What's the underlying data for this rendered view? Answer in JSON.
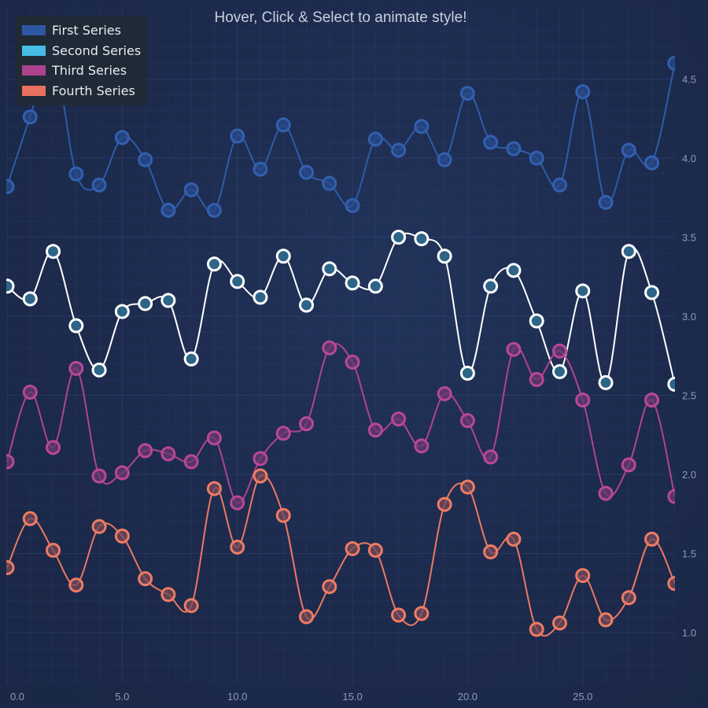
{
  "title": "Hover, Click & Select to animate style!",
  "legend": {
    "items": [
      {
        "label": "First Series",
        "color": "#2e57a3"
      },
      {
        "label": "Second Series",
        "color": "#47bde6"
      },
      {
        "label": "Third Series",
        "color": "#ae418d"
      },
      {
        "label": "Fourth Series",
        "color": "#e8705e"
      }
    ]
  },
  "chart_data": {
    "type": "line",
    "title": "Hover, Click & Select to animate style!",
    "xlabel": "",
    "ylabel": "",
    "xlim": [
      0,
      29
    ],
    "ylim": [
      0.67,
      4.96
    ],
    "grid": true,
    "legend_position": "top-left",
    "y_axis_position": "right",
    "x_ticks": [
      0,
      5,
      10,
      15,
      20,
      25
    ],
    "x_tick_labels": [
      "0.0",
      "5.0",
      "10.0",
      "15.0",
      "20.0",
      "25.0"
    ],
    "y_ticks": [
      1.0,
      1.5,
      2.0,
      2.5,
      3.0,
      3.5,
      4.0,
      4.5
    ],
    "y_tick_labels": [
      "1.0",
      "1.5",
      "2.0",
      "2.5",
      "3.0",
      "3.5",
      "4.0",
      "4.5"
    ],
    "x": [
      0,
      1,
      2,
      3,
      4,
      5,
      6,
      7,
      8,
      9,
      10,
      11,
      12,
      13,
      14,
      15,
      16,
      17,
      18,
      19,
      20,
      21,
      22,
      23,
      24,
      25,
      26,
      27,
      28,
      29
    ],
    "series": [
      {
        "name": "First Series",
        "line_color": "#2f5ba8",
        "marker_fill": "#284a8a",
        "marker_stroke": "#3260b0",
        "values": [
          3.82,
          4.26,
          4.65,
          3.9,
          3.83,
          4.13,
          3.99,
          3.67,
          3.8,
          3.67,
          4.14,
          3.93,
          4.21,
          3.91,
          3.84,
          3.7,
          4.12,
          4.05,
          4.2,
          3.99,
          4.41,
          4.1,
          4.06,
          4.0,
          3.83,
          4.42,
          3.72,
          4.05,
          3.97,
          4.6
        ]
      },
      {
        "name": "Second Series",
        "line_color": "#ffffff",
        "marker_fill": "#2d6488",
        "marker_stroke": "#ffffff",
        "values": [
          3.19,
          3.11,
          3.41,
          2.94,
          2.66,
          3.03,
          3.08,
          3.1,
          2.73,
          3.33,
          3.22,
          3.12,
          3.38,
          3.07,
          3.3,
          3.21,
          3.19,
          3.5,
          3.49,
          3.38,
          2.64,
          3.19,
          3.29,
          2.97,
          2.65,
          3.16,
          2.58,
          3.41,
          3.15,
          2.57
        ]
      },
      {
        "name": "Third Series",
        "line_color": "#b2438f",
        "marker_fill": "#6a3a6e",
        "marker_stroke": "#b9479a",
        "values": [
          2.08,
          2.52,
          2.17,
          2.67,
          1.99,
          2.01,
          2.15,
          2.13,
          2.08,
          2.23,
          1.82,
          2.1,
          2.26,
          2.32,
          2.8,
          2.71,
          2.28,
          2.35,
          2.18,
          2.51,
          2.34,
          2.11,
          2.79,
          2.6,
          2.78,
          2.47,
          1.88,
          2.06,
          2.47,
          1.86
        ]
      },
      {
        "name": "Fourth Series",
        "line_color": "#ec7862",
        "marker_fill": "#744a5a",
        "marker_stroke": "#ee7c63",
        "values": [
          1.41,
          1.72,
          1.52,
          1.3,
          1.67,
          1.61,
          1.34,
          1.24,
          1.17,
          1.91,
          1.54,
          1.99,
          1.74,
          1.1,
          1.29,
          1.53,
          1.52,
          1.11,
          1.12,
          1.81,
          1.92,
          1.51,
          1.59,
          1.02,
          1.06,
          1.36,
          1.08,
          1.22,
          1.59,
          1.31
        ]
      }
    ]
  }
}
